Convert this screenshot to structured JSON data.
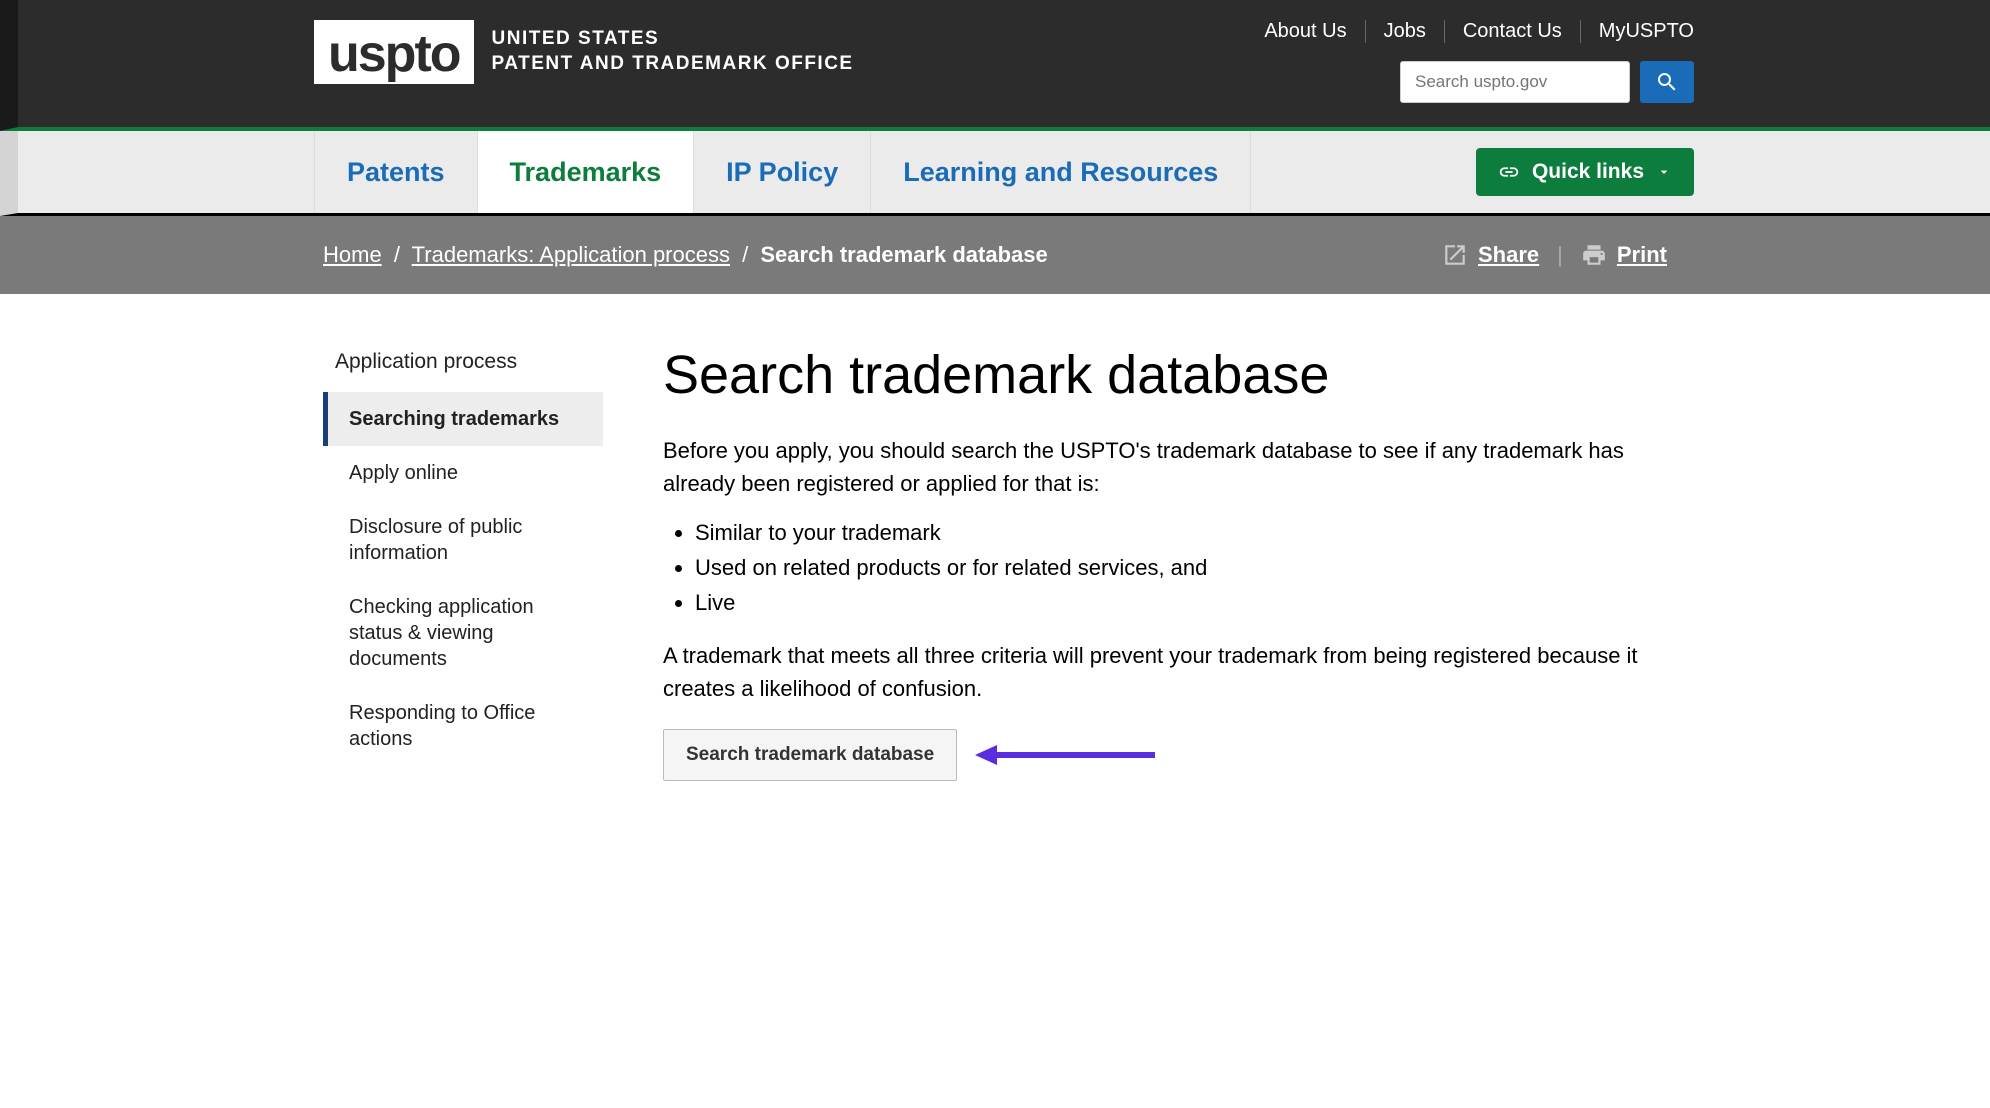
{
  "header": {
    "logo_text": "uspto",
    "org_line1": "UNITED STATES",
    "org_line2": "PATENT AND TRADEMARK OFFICE",
    "top_links": [
      "About Us",
      "Jobs",
      "Contact Us",
      "MyUSPTO"
    ],
    "search_placeholder": "Search uspto.gov"
  },
  "nav": {
    "items": [
      "Patents",
      "Trademarks",
      "IP Policy",
      "Learning and Resources"
    ],
    "active_index": 1,
    "quick_links_label": "Quick links"
  },
  "breadcrumb": {
    "home": "Home",
    "mid": "Trademarks: Application process",
    "current": "Search trademark database",
    "share": "Share",
    "print": "Print"
  },
  "sidebar": {
    "title": "Application process",
    "items": [
      "Searching trademarks",
      "Apply online",
      "Disclosure of public information",
      "Checking application status & viewing documents",
      "Responding to Office actions"
    ],
    "active_index": 0
  },
  "content": {
    "title": "Search trademark database",
    "intro": "Before you apply, you should search the USPTO's trademark database to see if any trademark has already been registered or applied for that is:",
    "bullets": [
      "Similar to your trademark",
      "Used on related products or for related services, and",
      "Live"
    ],
    "followup": "A trademark that meets all three criteria will prevent your trademark from being registered because it creates a likelihood of confusion.",
    "button": "Search trademark database"
  }
}
